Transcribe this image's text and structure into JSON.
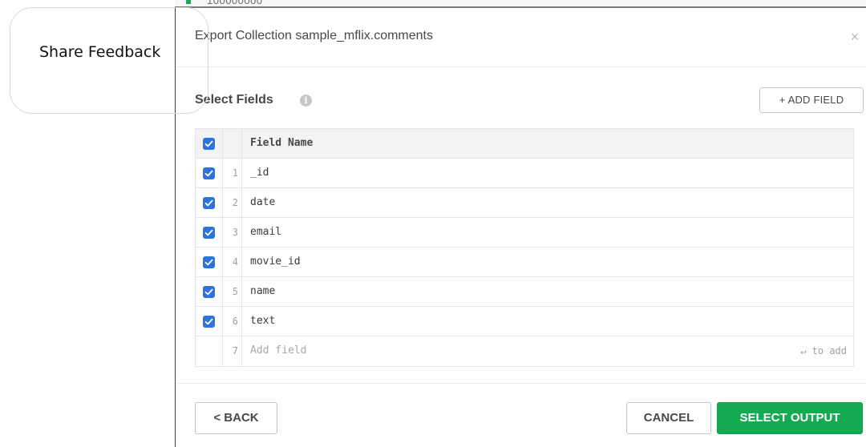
{
  "background": {
    "partial_text": "100000000"
  },
  "share_feedback": {
    "label": "Share Feedback"
  },
  "modal": {
    "title": "Export Collection sample_mflix.comments",
    "close_glyph": "×",
    "section_title": "Select Fields",
    "info_glyph": "i",
    "add_field_label": "+ ADD FIELD",
    "table": {
      "header": "Field Name",
      "rows": [
        {
          "num": "1",
          "name": "_id",
          "checked": true
        },
        {
          "num": "2",
          "name": "date",
          "checked": true
        },
        {
          "num": "3",
          "name": "email",
          "checked": true
        },
        {
          "num": "4",
          "name": "movie_id",
          "checked": true
        },
        {
          "num": "5",
          "name": "name",
          "checked": true
        },
        {
          "num": "6",
          "name": "text",
          "checked": true
        }
      ],
      "new_row": {
        "num": "7",
        "placeholder": "Add field",
        "hint": "↵ to add"
      }
    },
    "footer": {
      "back_label": "< BACK",
      "cancel_label": "CANCEL",
      "select_output_label": "SELECT OUTPUT"
    }
  },
  "colors": {
    "checkbox": "#2b73e1",
    "primary_button": "#13aa52"
  },
  "icons": {
    "close": "close-icon",
    "info": "info-icon",
    "checkbox": "checkbox-checked-icon"
  }
}
